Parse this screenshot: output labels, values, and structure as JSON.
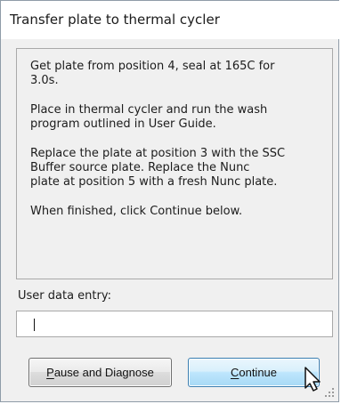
{
  "dialog": {
    "title": "Transfer plate to thermal cycler",
    "message_paragraphs": [
      "Get plate from position 4, seal at 165C for\n3.0s.",
      "Place in thermal cycler and run the wash\nprogram outlined in User Guide.",
      "Replace the plate at position 3 with the SSC\nBuffer source plate.  Replace the Nunc\nplate at position 5 with a fresh Nunc plate.",
      "When finished, click Continue below."
    ],
    "user_data_label": "User data entry:",
    "user_data_value": ""
  },
  "buttons": {
    "pause": {
      "mnemonic": "P",
      "rest": "ause and Diagnose"
    },
    "continue": {
      "mnemonic": "C",
      "rest": "ontinue"
    }
  },
  "icons": {
    "cursor": "mouse-pointer-icon",
    "resize": "size-grip-icon"
  },
  "colors": {
    "window_border": "#8f9ca8",
    "dialog_background": "#f0f0f0",
    "continue_border": "#3c7fb1",
    "continue_fill": "#bee6fd"
  }
}
